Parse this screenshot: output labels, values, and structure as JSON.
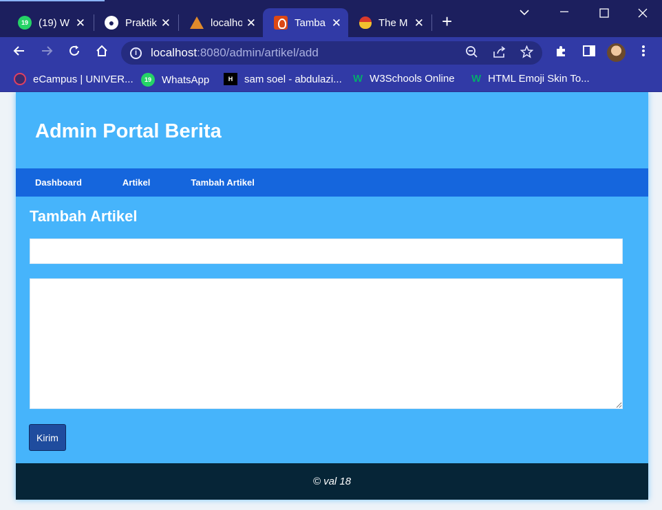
{
  "browser": {
    "tabs": [
      {
        "title": "(19) W",
        "favicon": "whatsapp-icon",
        "badge": "19"
      },
      {
        "title": "Praktik",
        "favicon": "globe-icon"
      },
      {
        "title": "localho",
        "favicon": "tent-logo-icon"
      },
      {
        "title": "Tamba",
        "favicon": "codeigniter-flame-icon",
        "active": true
      },
      {
        "title": "The M",
        "favicon": "mask-icon"
      }
    ],
    "url": {
      "host": "localhost",
      "rest": ":8080/admin/artikel/add"
    },
    "bookmarks": [
      {
        "label": "eCampus | UNIVER...",
        "icon": "ecampus-icon"
      },
      {
        "label": "WhatsApp",
        "icon": "whatsapp-icon",
        "badge": "19"
      },
      {
        "label": "sam soel - abdulazi...",
        "icon": "hashnode-icon",
        "badge": "H"
      },
      {
        "label": "W3Schools Online",
        "icon": "w3schools-icon"
      },
      {
        "label": "HTML Emoji Skin To...",
        "icon": "w3schools-icon"
      }
    ],
    "colors": {
      "tabbar": "#1c1f5e",
      "toolbar": "#313aa6"
    }
  },
  "site": {
    "title": "Admin Portal Berita",
    "nav": [
      "Dashboard",
      "Artikel",
      "Tambah Artikel"
    ],
    "page_heading": "Tambah Artikel",
    "form": {
      "title_value": "",
      "body_value": "",
      "submit_label": "Kirim"
    },
    "footer": "© val 18",
    "colors": {
      "page": "#46b4fb",
      "nav": "#1566dd",
      "footer": "#062537",
      "button": "#1f4c9e"
    }
  }
}
